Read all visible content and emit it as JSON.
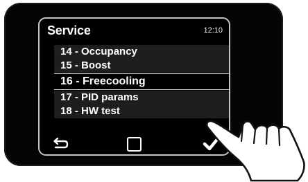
{
  "screen": {
    "title": "Service",
    "time": "12:10"
  },
  "menu": {
    "items": [
      {
        "label": "14 - Occupancy"
      },
      {
        "label": "15 - Boost"
      },
      {
        "label": "16 - Freecooling",
        "selected": true
      },
      {
        "label": "17 - PID params"
      },
      {
        "label": "18 - HW test"
      }
    ]
  },
  "nav": {
    "back_icon": "back-arrow-icon",
    "home_icon": "square-home-icon",
    "confirm_icon": "checkmark-icon"
  },
  "colors": {
    "screen_background": "#000000",
    "text": "#ffffff",
    "row_stripe": "#1e1e1e",
    "selection_line": "#d9d9d9",
    "bezel": "#050505",
    "screen_border": "#c4c4c4"
  }
}
